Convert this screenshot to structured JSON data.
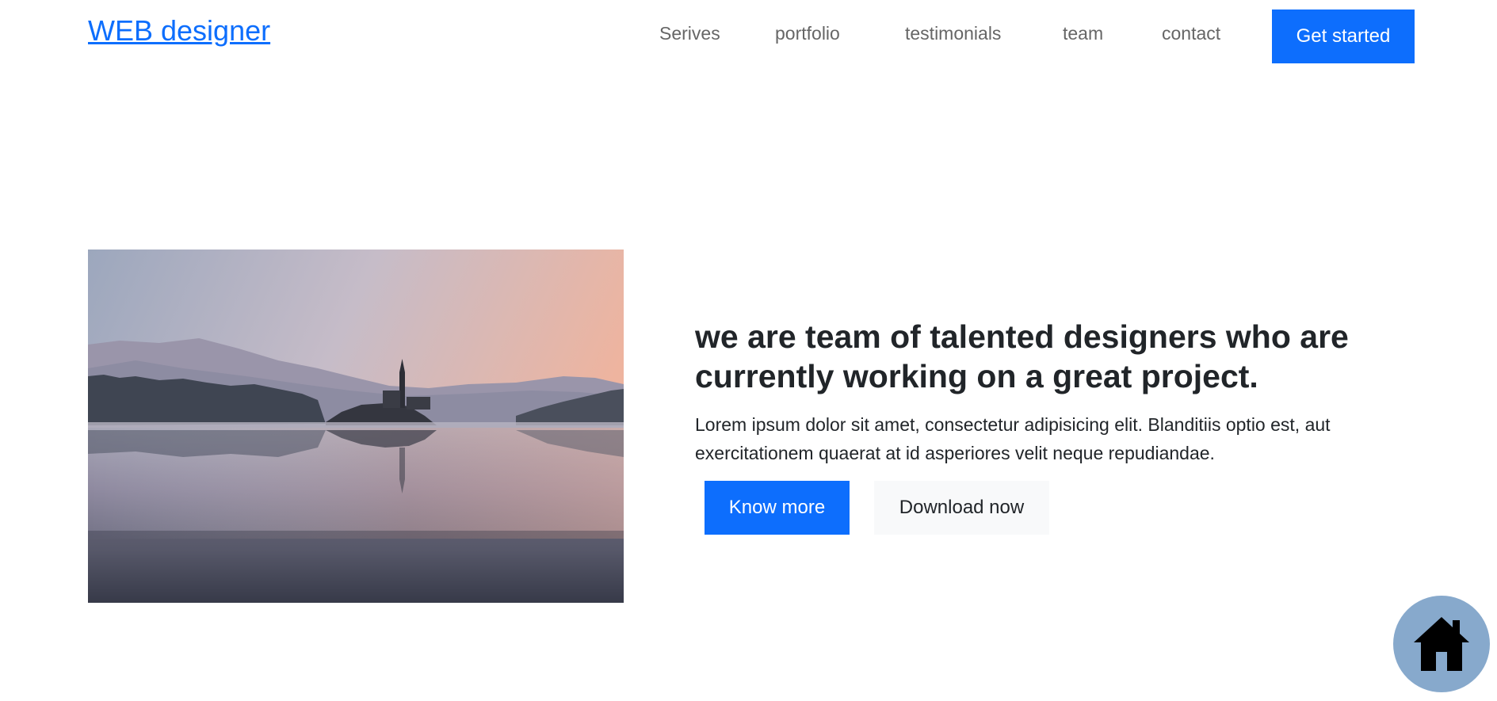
{
  "navbar": {
    "brand": "WEB designer",
    "links": [
      "Serives",
      "portfolio",
      "testimonials",
      "team",
      "contact"
    ],
    "cta_label": "Get started"
  },
  "hero": {
    "image_alt": "lake with island church at sunrise",
    "heading": "we are team of talented designers who are currently working on a great project.",
    "paragraph": "Lorem ipsum dolor sit amet, consectetur adipisicing elit. Blanditiis optio est, aut exercitationem quaerat at id asperiores velit neque repudiandae.",
    "primary_button": "Know more",
    "secondary_button": "Download now"
  },
  "floating": {
    "icon": "home-icon"
  },
  "colors": {
    "accent": "#0d6efd",
    "nav_text": "#666666",
    "fab_bg": "#87a9cc"
  }
}
